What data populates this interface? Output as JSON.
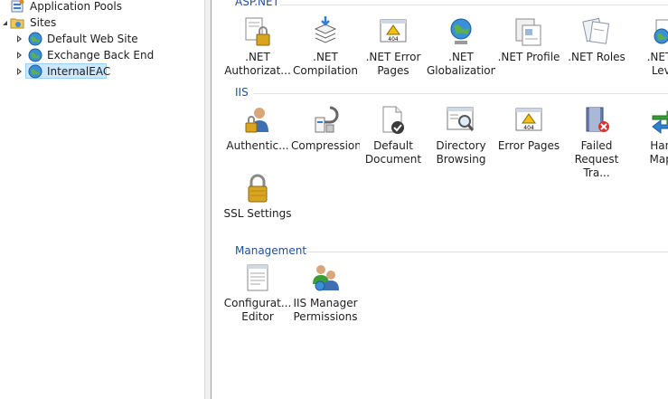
{
  "tree": {
    "app_pools": "Application Pools",
    "sites": "Sites",
    "site_items": [
      "Default Web Site",
      "Exchange Back End",
      "InternalEAC"
    ]
  },
  "groups": {
    "aspnet": {
      "title": "ASP.NET",
      "items": [
        ".NET\nAuthorizat...",
        ".NET\nCompilation",
        ".NET Error\nPages",
        ".NET\nGlobalization",
        ".NET Profile",
        ".NET Roles",
        ".NET T\nLeve"
      ]
    },
    "iis": {
      "title": "IIS",
      "items": [
        "Authentic...",
        "Compression",
        "Default\nDocument",
        "Directory\nBrowsing",
        "Error Pages",
        "Failed\nRequest Tra...",
        "Hand\nMapp",
        "SSL Settings"
      ]
    },
    "management": {
      "title": "Management",
      "items": [
        "Configurat...\nEditor",
        "IIS Manager\nPermissions"
      ]
    }
  },
  "icons": {
    "aspnet": [
      "authorization-icon",
      "compilation-icon",
      "error-page-404-icon",
      "globe-icon",
      "profile-icon",
      "roles-icon",
      "trust-level-icon"
    ],
    "iis": [
      "authentication-icon",
      "compression-icon",
      "default-document-icon",
      "directory-browsing-icon",
      "error-page-404-icon",
      "failed-request-icon",
      "handler-mappings-icon",
      "ssl-lock-icon"
    ],
    "management": [
      "configuration-editor-icon",
      "iis-manager-permissions-icon"
    ]
  },
  "colors": {
    "group_header": "#1f4e9a",
    "selection": "#cce8ff",
    "selection_border": "#99d1ff"
  }
}
